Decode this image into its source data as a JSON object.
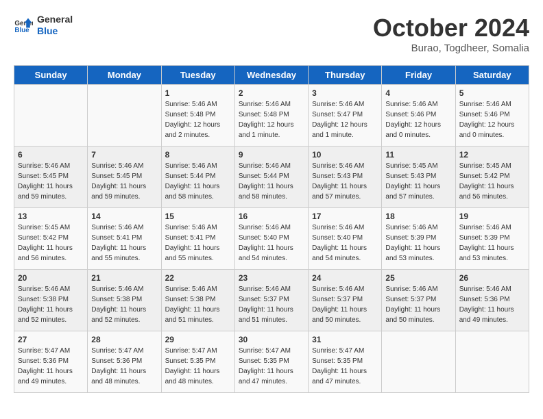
{
  "header": {
    "logo_line1": "General",
    "logo_line2": "Blue",
    "month": "October 2024",
    "location": "Burao, Togdheer, Somalia"
  },
  "days_of_week": [
    "Sunday",
    "Monday",
    "Tuesday",
    "Wednesday",
    "Thursday",
    "Friday",
    "Saturday"
  ],
  "weeks": [
    [
      {
        "day": "",
        "info": ""
      },
      {
        "day": "",
        "info": ""
      },
      {
        "day": "1",
        "info": "Sunrise: 5:46 AM\nSunset: 5:48 PM\nDaylight: 12 hours\nand 2 minutes."
      },
      {
        "day": "2",
        "info": "Sunrise: 5:46 AM\nSunset: 5:48 PM\nDaylight: 12 hours\nand 1 minute."
      },
      {
        "day": "3",
        "info": "Sunrise: 5:46 AM\nSunset: 5:47 PM\nDaylight: 12 hours\nand 1 minute."
      },
      {
        "day": "4",
        "info": "Sunrise: 5:46 AM\nSunset: 5:46 PM\nDaylight: 12 hours\nand 0 minutes."
      },
      {
        "day": "5",
        "info": "Sunrise: 5:46 AM\nSunset: 5:46 PM\nDaylight: 12 hours\nand 0 minutes."
      }
    ],
    [
      {
        "day": "6",
        "info": "Sunrise: 5:46 AM\nSunset: 5:45 PM\nDaylight: 11 hours\nand 59 minutes."
      },
      {
        "day": "7",
        "info": "Sunrise: 5:46 AM\nSunset: 5:45 PM\nDaylight: 11 hours\nand 59 minutes."
      },
      {
        "day": "8",
        "info": "Sunrise: 5:46 AM\nSunset: 5:44 PM\nDaylight: 11 hours\nand 58 minutes."
      },
      {
        "day": "9",
        "info": "Sunrise: 5:46 AM\nSunset: 5:44 PM\nDaylight: 11 hours\nand 58 minutes."
      },
      {
        "day": "10",
        "info": "Sunrise: 5:46 AM\nSunset: 5:43 PM\nDaylight: 11 hours\nand 57 minutes."
      },
      {
        "day": "11",
        "info": "Sunrise: 5:45 AM\nSunset: 5:43 PM\nDaylight: 11 hours\nand 57 minutes."
      },
      {
        "day": "12",
        "info": "Sunrise: 5:45 AM\nSunset: 5:42 PM\nDaylight: 11 hours\nand 56 minutes."
      }
    ],
    [
      {
        "day": "13",
        "info": "Sunrise: 5:45 AM\nSunset: 5:42 PM\nDaylight: 11 hours\nand 56 minutes."
      },
      {
        "day": "14",
        "info": "Sunrise: 5:46 AM\nSunset: 5:41 PM\nDaylight: 11 hours\nand 55 minutes."
      },
      {
        "day": "15",
        "info": "Sunrise: 5:46 AM\nSunset: 5:41 PM\nDaylight: 11 hours\nand 55 minutes."
      },
      {
        "day": "16",
        "info": "Sunrise: 5:46 AM\nSunset: 5:40 PM\nDaylight: 11 hours\nand 54 minutes."
      },
      {
        "day": "17",
        "info": "Sunrise: 5:46 AM\nSunset: 5:40 PM\nDaylight: 11 hours\nand 54 minutes."
      },
      {
        "day": "18",
        "info": "Sunrise: 5:46 AM\nSunset: 5:39 PM\nDaylight: 11 hours\nand 53 minutes."
      },
      {
        "day": "19",
        "info": "Sunrise: 5:46 AM\nSunset: 5:39 PM\nDaylight: 11 hours\nand 53 minutes."
      }
    ],
    [
      {
        "day": "20",
        "info": "Sunrise: 5:46 AM\nSunset: 5:38 PM\nDaylight: 11 hours\nand 52 minutes."
      },
      {
        "day": "21",
        "info": "Sunrise: 5:46 AM\nSunset: 5:38 PM\nDaylight: 11 hours\nand 52 minutes."
      },
      {
        "day": "22",
        "info": "Sunrise: 5:46 AM\nSunset: 5:38 PM\nDaylight: 11 hours\nand 51 minutes."
      },
      {
        "day": "23",
        "info": "Sunrise: 5:46 AM\nSunset: 5:37 PM\nDaylight: 11 hours\nand 51 minutes."
      },
      {
        "day": "24",
        "info": "Sunrise: 5:46 AM\nSunset: 5:37 PM\nDaylight: 11 hours\nand 50 minutes."
      },
      {
        "day": "25",
        "info": "Sunrise: 5:46 AM\nSunset: 5:37 PM\nDaylight: 11 hours\nand 50 minutes."
      },
      {
        "day": "26",
        "info": "Sunrise: 5:46 AM\nSunset: 5:36 PM\nDaylight: 11 hours\nand 49 minutes."
      }
    ],
    [
      {
        "day": "27",
        "info": "Sunrise: 5:47 AM\nSunset: 5:36 PM\nDaylight: 11 hours\nand 49 minutes."
      },
      {
        "day": "28",
        "info": "Sunrise: 5:47 AM\nSunset: 5:36 PM\nDaylight: 11 hours\nand 48 minutes."
      },
      {
        "day": "29",
        "info": "Sunrise: 5:47 AM\nSunset: 5:35 PM\nDaylight: 11 hours\nand 48 minutes."
      },
      {
        "day": "30",
        "info": "Sunrise: 5:47 AM\nSunset: 5:35 PM\nDaylight: 11 hours\nand 47 minutes."
      },
      {
        "day": "31",
        "info": "Sunrise: 5:47 AM\nSunset: 5:35 PM\nDaylight: 11 hours\nand 47 minutes."
      },
      {
        "day": "",
        "info": ""
      },
      {
        "day": "",
        "info": ""
      }
    ]
  ]
}
